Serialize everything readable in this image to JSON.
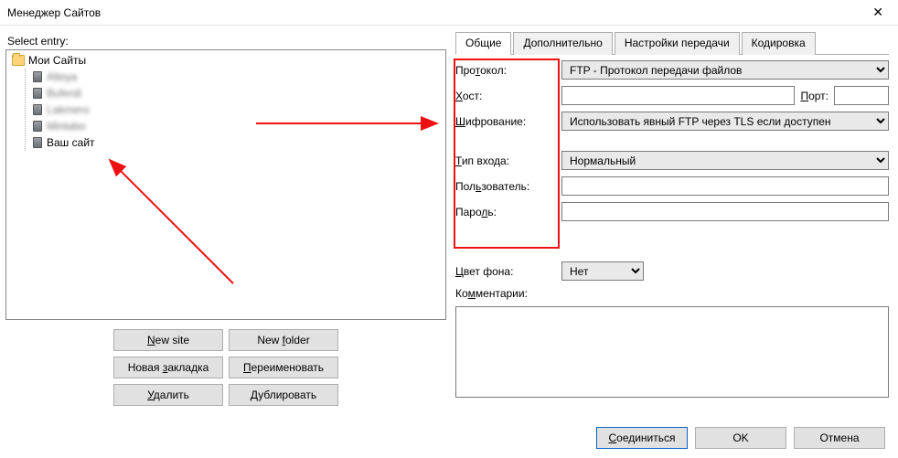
{
  "window": {
    "title": "Менеджер Сайтов"
  },
  "left": {
    "select_label": "Select entry:",
    "root_label": "Мои Сайты",
    "items": [
      {
        "label": "Alteya",
        "blurred": true
      },
      {
        "label": "Buferdi",
        "blurred": true
      },
      {
        "label": "Lakmero",
        "blurred": true
      },
      {
        "label": "Mintabo",
        "blurred": true
      },
      {
        "label": "Ваш сайт",
        "blurred": false
      }
    ],
    "buttons": {
      "new_site": "New site",
      "new_folder": "New folder",
      "new_bookmark": "Новая закладка",
      "rename": "Переименовать",
      "delete": "Удалить",
      "duplicate": "Дублировать"
    }
  },
  "tabs": {
    "general": "Общие",
    "advanced": "Дополнительно",
    "transfer": "Настройки передачи",
    "charset": "Кодировка"
  },
  "form": {
    "protocol_label": "Протокол:",
    "protocol_value": "FTP - Протокол передачи файлов",
    "host_label": "Хост:",
    "host_value": "",
    "port_label": "Порт:",
    "port_value": "",
    "encryption_label": "Шифрование:",
    "encryption_value": "Использовать явный FTP через TLS если доступен",
    "logon_label": "Тип входа:",
    "logon_value": "Нормальный",
    "user_label": "Пользователь:",
    "user_value": "",
    "pass_label": "Пароль:",
    "pass_value": "",
    "bgcolor_label": "Цвет фона:",
    "bgcolor_value": "Нет",
    "comments_label": "Комментарии:",
    "comments_value": ""
  },
  "bottom": {
    "connect": "Соединиться",
    "ok": "OK",
    "cancel": "Отмена"
  }
}
